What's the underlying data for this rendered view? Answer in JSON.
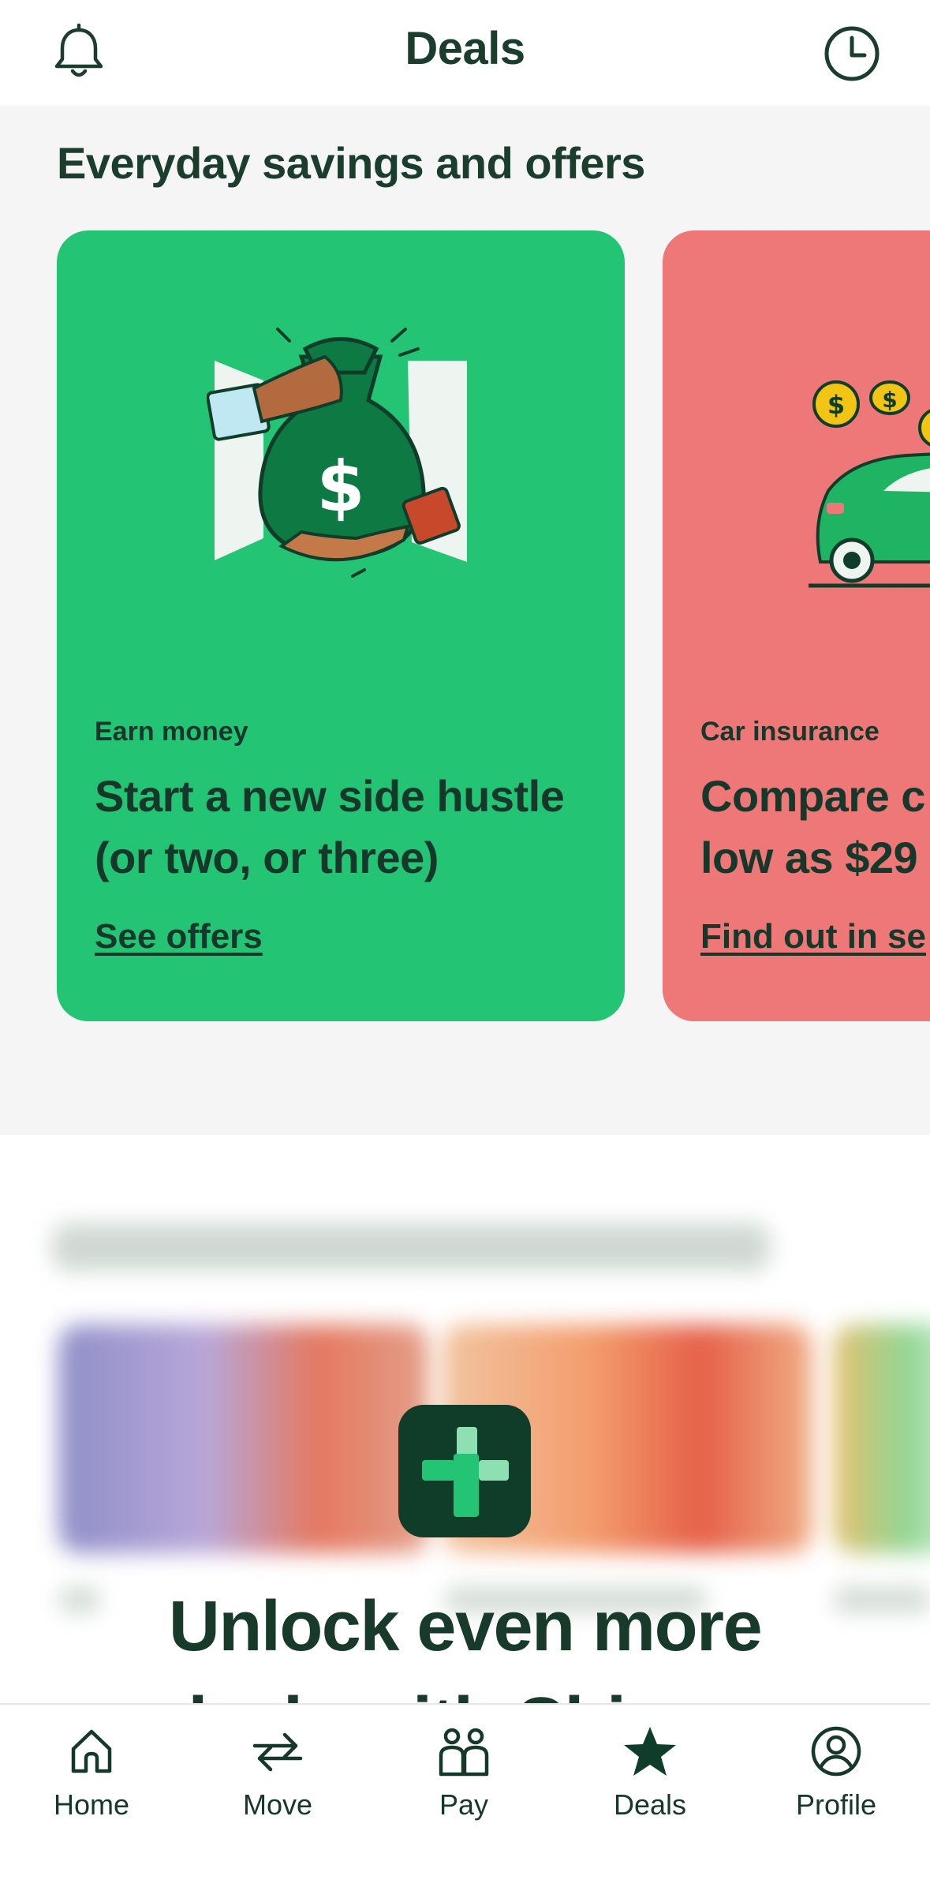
{
  "header": {
    "title": "Deals",
    "left_icon": "bell-icon",
    "right_icon": "clock-history-icon"
  },
  "offers": {
    "heading": "Everyday savings and offers",
    "cards": [
      {
        "eyebrow": "Earn money",
        "headline": "Start a new side hustle (or two, or three)",
        "link": "See offers",
        "color": "#23c474",
        "illustration": "money-bag-handoff"
      },
      {
        "eyebrow": "Car insurance",
        "headline_line1": "Compare c",
        "headline_line2": "low as $29",
        "link": "Find out in se",
        "color": "#ee7777",
        "illustration": "car-with-coins"
      }
    ]
  },
  "promo": {
    "icon": "plus-tile-icon",
    "line1": "Unlock even more",
    "line2": "deals with Chime+"
  },
  "tabbar": {
    "items": [
      {
        "label": "Home",
        "icon": "home-icon",
        "active": false
      },
      {
        "label": "Move",
        "icon": "transfer-arrows-icon",
        "active": false
      },
      {
        "label": "Pay",
        "icon": "people-icon",
        "active": false
      },
      {
        "label": "Deals",
        "icon": "star-icon",
        "active": true
      },
      {
        "label": "Profile",
        "icon": "profile-icon",
        "active": false
      }
    ]
  },
  "colors": {
    "brand_dark": "#1b3d2e",
    "green_card": "#23c474",
    "red_card": "#ee7777",
    "section_bg": "#f5f5f5"
  }
}
